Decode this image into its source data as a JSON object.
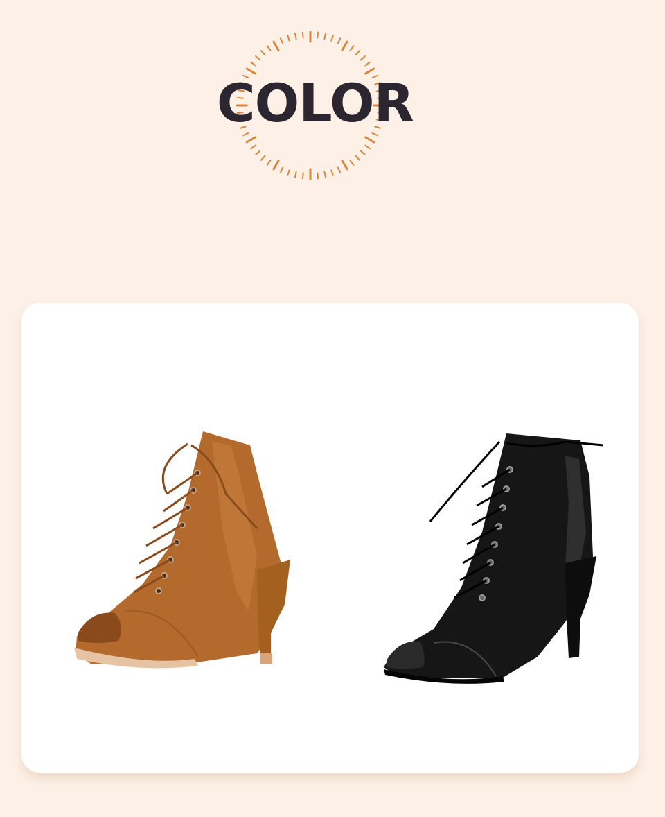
{
  "section_title": "COLOR",
  "colors": {
    "background": "#fdf0e6",
    "title_text": "#2b2630",
    "dial_accent": "#d9853a",
    "card": "#ffffff"
  },
  "products": [
    {
      "variant_color": "#b36a2c",
      "icon": "lace-up-peep-toe-ankle-boot"
    },
    {
      "variant_color": "#161616",
      "icon": "lace-up-peep-toe-ankle-boot"
    }
  ]
}
